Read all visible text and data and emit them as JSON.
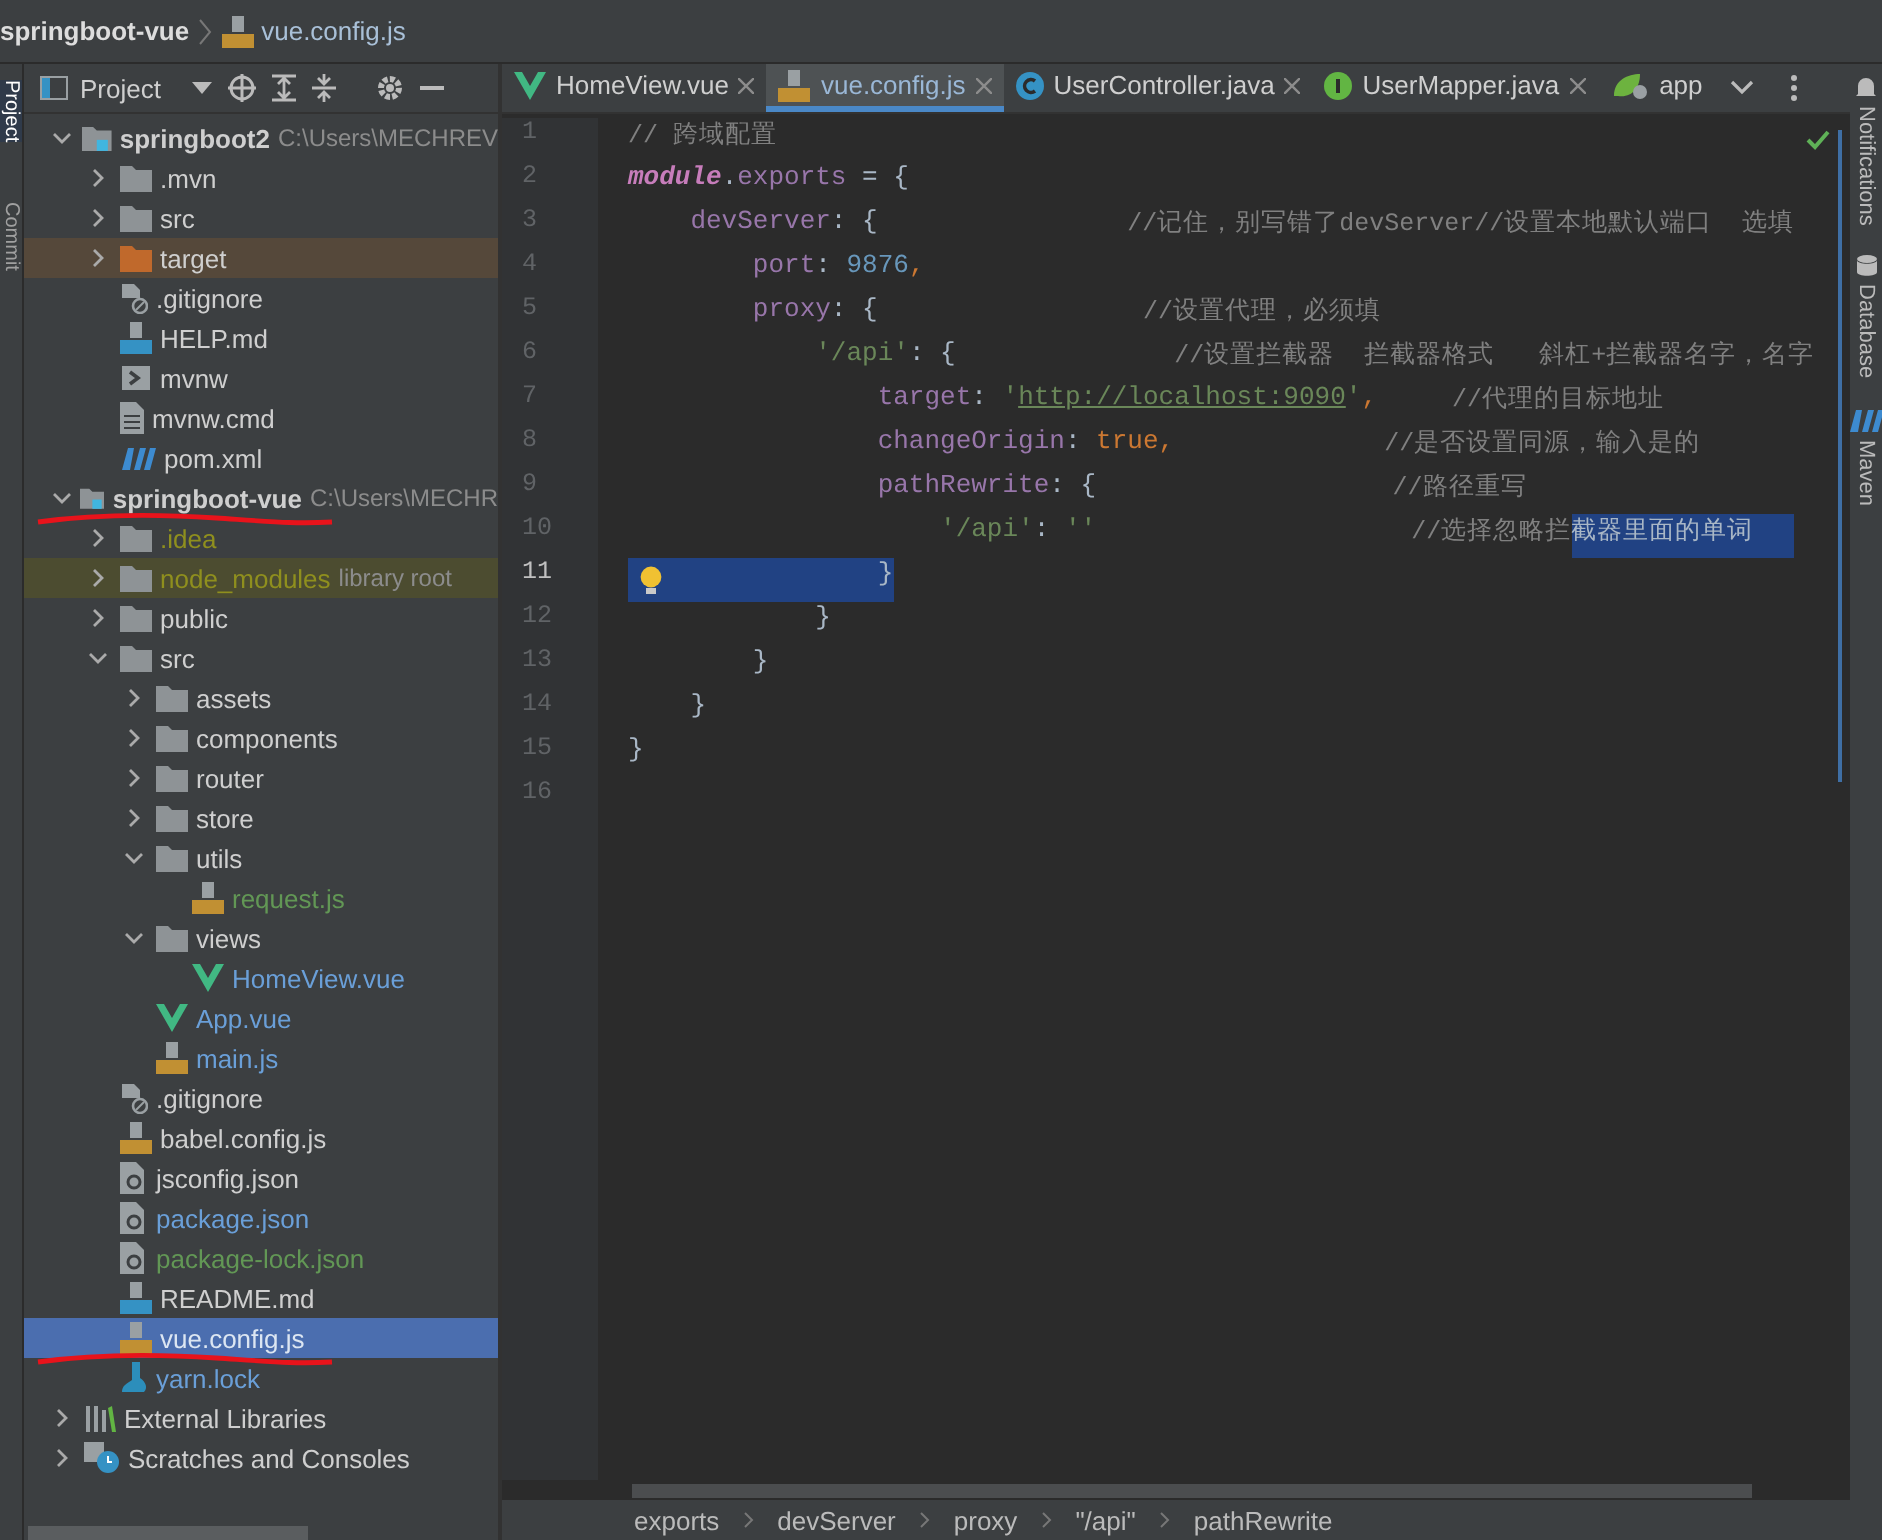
{
  "breadcrumb": {
    "project": "springboot-vue",
    "file": "vue.config.js"
  },
  "left_strip": [
    {
      "label": "Project",
      "selected": true
    },
    {
      "label": "Commit",
      "selected": false
    }
  ],
  "project_panel": {
    "title": "Project",
    "tree": [
      {
        "label": "springboot2",
        "hint": "C:\\Users\\MECHREV",
        "kind": "module",
        "color": "#cfcfcf",
        "excluded": false,
        "library_root": false,
        "selected": false,
        "expanded": true,
        "underlined": false,
        "children": [
          {
            "label": ".mvn",
            "kind": "folder",
            "color": "#cfcfcf",
            "excluded": false,
            "library_root": false,
            "selected": false,
            "expanded": false,
            "underlined": false
          },
          {
            "label": "src",
            "kind": "folder",
            "color": "#cfcfcf",
            "excluded": false,
            "library_root": false,
            "selected": false,
            "expanded": false,
            "underlined": false
          },
          {
            "label": "target",
            "kind": "folder",
            "color": "#cfcfcf",
            "excluded": true,
            "library_root": false,
            "selected": false,
            "expanded": false,
            "underlined": false
          },
          {
            "label": ".gitignore",
            "kind": "gitignore",
            "color": "#cfcfcf",
            "excluded": false,
            "library_root": false,
            "selected": false,
            "underlined": false
          },
          {
            "label": "HELP.md",
            "kind": "md",
            "color": "#cfcfcf",
            "excluded": false,
            "library_root": false,
            "selected": false,
            "underlined": false
          },
          {
            "label": "mvnw",
            "kind": "script",
            "color": "#cfcfcf",
            "excluded": false,
            "library_root": false,
            "selected": false,
            "underlined": false
          },
          {
            "label": "mvnw.cmd",
            "kind": "text",
            "color": "#cfcfcf",
            "excluded": false,
            "library_root": false,
            "selected": false,
            "underlined": false
          },
          {
            "label": "pom.xml",
            "kind": "maven",
            "color": "#cfcfcf",
            "excluded": false,
            "library_root": false,
            "selected": false,
            "underlined": false
          }
        ]
      },
      {
        "label": "springboot-vue",
        "hint": "C:\\Users\\MECHR",
        "kind": "module",
        "color": "#cfcfcf",
        "excluded": false,
        "library_root": false,
        "selected": false,
        "expanded": true,
        "underlined": true,
        "children": [
          {
            "label": ".idea",
            "kind": "folder",
            "color": "#8f8f1e",
            "excluded": false,
            "library_root": false,
            "selected": false,
            "expanded": false,
            "underlined": false
          },
          {
            "label": "node_modules",
            "hint": "library root",
            "kind": "folder",
            "color": "#8f8f1e",
            "excluded": false,
            "library_root": true,
            "selected": false,
            "expanded": false,
            "underlined": false
          },
          {
            "label": "public",
            "kind": "folder",
            "color": "#cfcfcf",
            "excluded": false,
            "library_root": false,
            "selected": false,
            "expanded": false,
            "underlined": false
          },
          {
            "label": "src",
            "kind": "folder",
            "color": "#cfcfcf",
            "excluded": false,
            "library_root": false,
            "selected": false,
            "expanded": true,
            "underlined": false,
            "children": [
              {
                "label": "assets",
                "kind": "folder",
                "color": "#cfcfcf",
                "excluded": false,
                "library_root": false,
                "selected": false,
                "expanded": false,
                "underlined": false
              },
              {
                "label": "components",
                "kind": "folder",
                "color": "#cfcfcf",
                "excluded": false,
                "library_root": false,
                "selected": false,
                "expanded": false,
                "underlined": false
              },
              {
                "label": "router",
                "kind": "folder",
                "color": "#cfcfcf",
                "excluded": false,
                "library_root": false,
                "selected": false,
                "expanded": false,
                "underlined": false
              },
              {
                "label": "store",
                "kind": "folder",
                "color": "#cfcfcf",
                "excluded": false,
                "library_root": false,
                "selected": false,
                "expanded": false,
                "underlined": false
              },
              {
                "label": "utils",
                "kind": "folder",
                "color": "#cfcfcf",
                "excluded": false,
                "library_root": false,
                "selected": false,
                "expanded": true,
                "underlined": false,
                "children": [
                  {
                    "label": "request.js",
                    "kind": "js",
                    "color": "#629755",
                    "excluded": false,
                    "library_root": false,
                    "selected": false,
                    "underlined": false
                  }
                ]
              },
              {
                "label": "views",
                "kind": "folder",
                "color": "#cfcfcf",
                "excluded": false,
                "library_root": false,
                "selected": false,
                "expanded": true,
                "underlined": false,
                "children": [
                  {
                    "label": "HomeView.vue",
                    "kind": "vue",
                    "color": "#6a9fd8",
                    "excluded": false,
                    "library_root": false,
                    "selected": false,
                    "underlined": false
                  }
                ]
              },
              {
                "label": "App.vue",
                "kind": "vue",
                "color": "#6a9fd8",
                "excluded": false,
                "library_root": false,
                "selected": false,
                "underlined": false
              },
              {
                "label": "main.js",
                "kind": "js",
                "color": "#6a9fd8",
                "excluded": false,
                "library_root": false,
                "selected": false,
                "underlined": false
              }
            ]
          },
          {
            "label": ".gitignore",
            "kind": "gitignore",
            "color": "#cfcfcf",
            "excluded": false,
            "library_root": false,
            "selected": false,
            "underlined": false
          },
          {
            "label": "babel.config.js",
            "kind": "js",
            "color": "#cfcfcf",
            "excluded": false,
            "library_root": false,
            "selected": false,
            "underlined": false
          },
          {
            "label": "jsconfig.json",
            "kind": "json",
            "color": "#cfcfcf",
            "excluded": false,
            "library_root": false,
            "selected": false,
            "underlined": false
          },
          {
            "label": "package.json",
            "kind": "json",
            "color": "#6a9fd8",
            "excluded": false,
            "library_root": false,
            "selected": false,
            "underlined": false
          },
          {
            "label": "package-lock.json",
            "kind": "json",
            "color": "#629755",
            "excluded": false,
            "library_root": false,
            "selected": false,
            "underlined": false
          },
          {
            "label": "README.md",
            "kind": "md",
            "color": "#cfcfcf",
            "excluded": false,
            "library_root": false,
            "selected": false,
            "underlined": false
          },
          {
            "label": "vue.config.js",
            "kind": "js",
            "color": "#dce6f2",
            "excluded": false,
            "library_root": false,
            "selected": true,
            "underlined": true
          },
          {
            "label": "yarn.lock",
            "kind": "yarn",
            "color": "#6a9fd8",
            "excluded": false,
            "library_root": false,
            "selected": false,
            "underlined": false
          }
        ]
      },
      {
        "label": "External Libraries",
        "kind": "libraries",
        "color": "#cfcfcf",
        "excluded": false,
        "library_root": false,
        "selected": false,
        "expanded": false,
        "underlined": false
      },
      {
        "label": "Scratches and Consoles",
        "kind": "scratches",
        "color": "#cfcfcf",
        "excluded": false,
        "library_root": false,
        "selected": false,
        "expanded": false,
        "underlined": false
      }
    ]
  },
  "tabs": [
    {
      "label": "HomeView.vue",
      "kind": "vue",
      "selected": false,
      "closable": true
    },
    {
      "label": "vue.config.js",
      "kind": "js",
      "selected": true,
      "closable": true
    },
    {
      "label": "UserController.java",
      "kind": "class",
      "selected": false,
      "closable": true
    },
    {
      "label": "UserMapper.java",
      "kind": "interface",
      "selected": false,
      "closable": true
    },
    {
      "label": "app",
      "kind": "spring",
      "selected": false,
      "closable": false
    }
  ],
  "code": [
    {
      "number": "1",
      "highlighted": false,
      "bulb": false,
      "tokens": [
        {
          "t": "// 跨域配置",
          "kind": "comment"
        }
      ]
    },
    {
      "number": "2",
      "highlighted": false,
      "bulb": false,
      "tokens": [
        {
          "t": "module",
          "kind": "global"
        },
        {
          "t": ".",
          "kind": "plain"
        },
        {
          "t": "exports",
          "kind": "field"
        },
        {
          "t": " = {",
          "kind": "plain"
        }
      ]
    },
    {
      "number": "3",
      "highlighted": false,
      "bulb": false,
      "tokens": [
        {
          "t": "    devServer",
          "kind": "field"
        },
        {
          "t": ": {                ",
          "kind": "plain"
        },
        {
          "t": "//记住，别写错了devServer//设置本地默认端口  选填",
          "kind": "comment"
        }
      ]
    },
    {
      "number": "4",
      "highlighted": false,
      "bulb": false,
      "tokens": [
        {
          "t": "        port",
          "kind": "field"
        },
        {
          "t": ": ",
          "kind": "plain"
        },
        {
          "t": "9876",
          "kind": "number"
        },
        {
          "t": ",",
          "kind": "keyword"
        }
      ]
    },
    {
      "number": "5",
      "highlighted": false,
      "bulb": false,
      "tokens": [
        {
          "t": "        proxy",
          "kind": "field"
        },
        {
          "t": ": {                 ",
          "kind": "plain"
        },
        {
          "t": "//设置代理，必须填",
          "kind": "comment"
        }
      ]
    },
    {
      "number": "6",
      "highlighted": false,
      "bulb": false,
      "tokens": [
        {
          "t": "            '/api'",
          "kind": "string"
        },
        {
          "t": ": {              ",
          "kind": "plain"
        },
        {
          "t": "//设置拦截器  拦截器格式   斜杠+拦截器名字，名字",
          "kind": "comment"
        }
      ]
    },
    {
      "number": "7",
      "highlighted": false,
      "bulb": false,
      "tokens": [
        {
          "t": "                target",
          "kind": "field"
        },
        {
          "t": ": ",
          "kind": "plain"
        },
        {
          "t": "'",
          "kind": "string"
        },
        {
          "t": "http://localhost:9090",
          "kind": "link"
        },
        {
          "t": "'",
          "kind": "string"
        },
        {
          "t": ",",
          "kind": "keyword"
        },
        {
          "t": "     //代理的目标地址",
          "kind": "comment"
        }
      ]
    },
    {
      "number": "8",
      "highlighted": false,
      "bulb": false,
      "tokens": [
        {
          "t": "                changeOrigin",
          "kind": "field"
        },
        {
          "t": ": ",
          "kind": "plain"
        },
        {
          "t": "true",
          "kind": "keyword"
        },
        {
          "t": ",",
          "kind": "keyword"
        },
        {
          "t": "              //是否设置同源，输入是的",
          "kind": "comment"
        }
      ]
    },
    {
      "number": "9",
      "highlighted": false,
      "bulb": false,
      "tokens": [
        {
          "t": "                pathRewrite",
          "kind": "field"
        },
        {
          "t": ": {                   ",
          "kind": "plain"
        },
        {
          "t": "//路径重写",
          "kind": "comment"
        }
      ]
    },
    {
      "number": "10",
      "highlighted": false,
      "bulb": false,
      "tokens": [
        {
          "t": "                    '/api'",
          "kind": "string"
        },
        {
          "t": ": ",
          "kind": "plain"
        },
        {
          "t": "''",
          "kind": "string"
        },
        {
          "t": "                     //选择忽略拦",
          "kind": "comment"
        },
        {
          "t": "截器里面的单词",
          "kind": "selected"
        }
      ]
    },
    {
      "number": "11",
      "highlighted": true,
      "bulb": true,
      "tokens": [
        {
          "t": "                }",
          "kind": "plain"
        }
      ]
    },
    {
      "number": "12",
      "highlighted": false,
      "bulb": false,
      "tokens": [
        {
          "t": "            }",
          "kind": "plain"
        }
      ]
    },
    {
      "number": "13",
      "highlighted": false,
      "bulb": false,
      "tokens": [
        {
          "t": "        }",
          "kind": "plain"
        }
      ]
    },
    {
      "number": "14",
      "highlighted": false,
      "bulb": false,
      "tokens": [
        {
          "t": "    }",
          "kind": "plain"
        }
      ]
    },
    {
      "number": "15",
      "highlighted": false,
      "bulb": false,
      "tokens": [
        {
          "t": "}",
          "kind": "plain"
        }
      ]
    },
    {
      "number": "16",
      "highlighted": false,
      "bulb": false
    }
  ],
  "right_strip": [
    {
      "label": "Notifications",
      "kind": "bell"
    },
    {
      "label": "Database",
      "kind": "database"
    },
    {
      "label": "Maven",
      "kind": "maven"
    }
  ],
  "code_breadcrumbs": [
    "exports",
    "devServer",
    "proxy",
    "\"/api\"",
    "pathRewrite"
  ]
}
